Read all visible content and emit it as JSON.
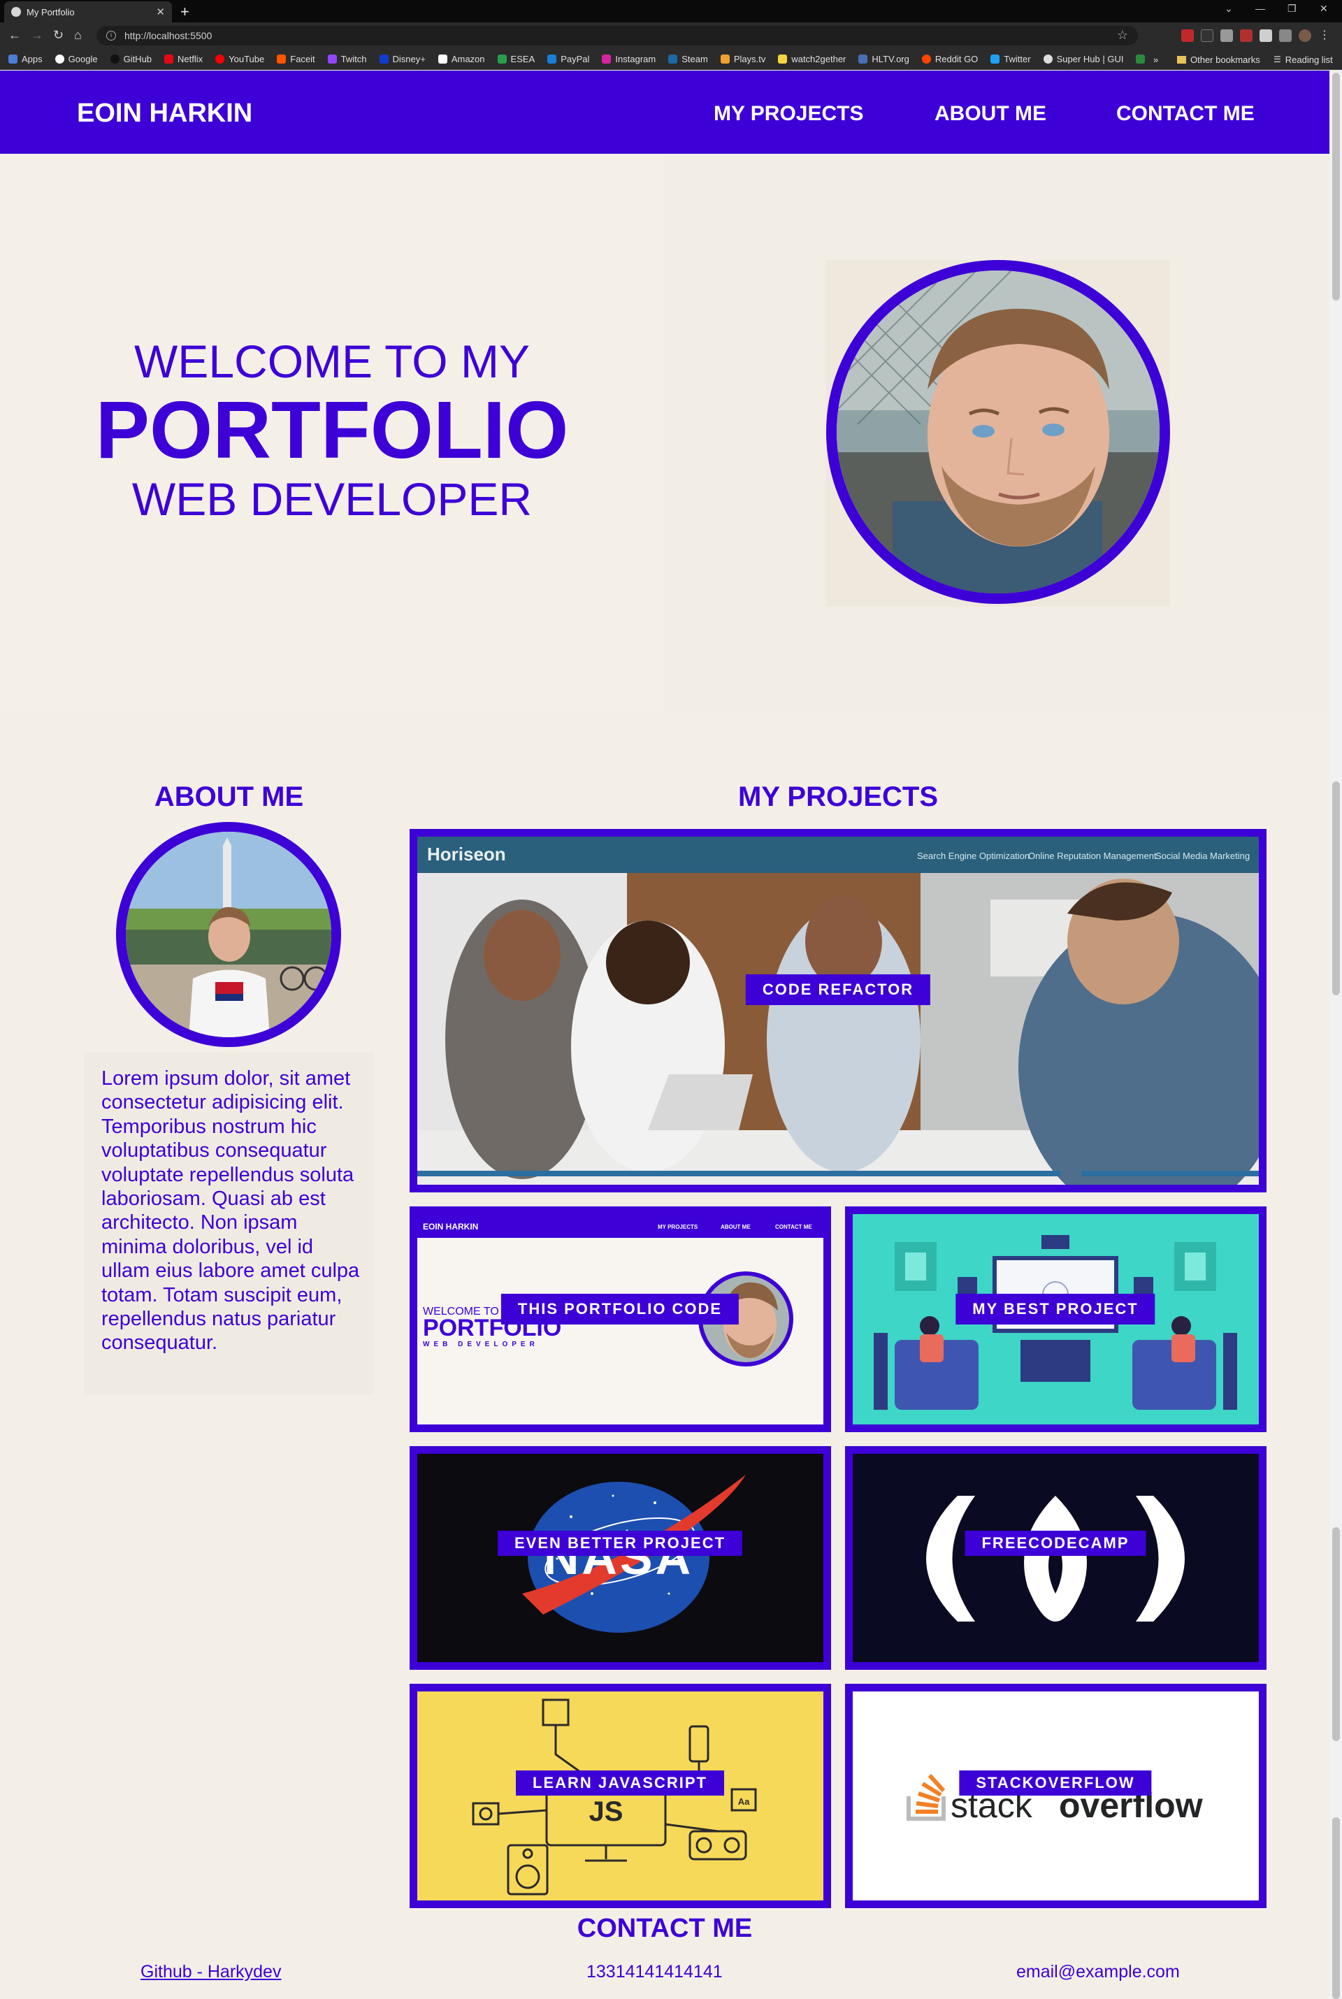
{
  "browser": {
    "tab_title": "My Portfolio",
    "url": "http://localhost:5500",
    "bookmarks": [
      "Apps",
      "Google",
      "GitHub",
      "Netflix",
      "YouTube",
      "Faceit",
      "Twitch",
      "Disney+",
      "Amazon",
      "ESEA",
      "PayPal",
      "Instagram",
      "Steam",
      "Plays.tv",
      "watch2gether",
      "HLTV.org",
      "Reddit GO",
      "Twitter",
      "Super Hub | GUI"
    ],
    "other_bookmarks": "Other bookmarks",
    "reading_list": "Reading list"
  },
  "nav": {
    "brand": "EOIN HARKIN",
    "links": [
      "MY PROJECTS",
      "ABOUT ME",
      "CONTACT ME"
    ]
  },
  "hero": {
    "line1": "WELCOME TO MY",
    "line2": "PORTFOLIO",
    "line3": "WEB DEVELOPER"
  },
  "about": {
    "title": "ABOUT ME",
    "text": "Lorem ipsum dolor, sit amet consectetur adipisicing elit. Temporibus nostrum hic voluptatibus consequatur voluptate repellendus soluta laboriosam. Quasi ab est architecto. Non ipsam minima doloribus, vel id ullam eius labore amet culpa totam. Totam suscipit eum, repellendus natus pariatur consequatur."
  },
  "projects": {
    "title": "MY PROJECTS",
    "items": [
      {
        "label": "CODE REFACTOR"
      },
      {
        "label": "THIS PORTFOLIO CODE"
      },
      {
        "label": "MY BEST PROJECT"
      },
      {
        "label": "EVEN BETTER PROJECT"
      },
      {
        "label": "FREECODECAMP"
      },
      {
        "label": "LEARN JAVASCRIPT"
      },
      {
        "label": "STACKOVERFLOW"
      }
    ],
    "thumbnails": {
      "horiseon_brand": "Horiseon",
      "horiseon_nav": [
        "Search Engine Optimization",
        "Online Reputation Management",
        "Social Media Marketing"
      ],
      "portfolio_brand": "EOIN HARKIN",
      "portfolio_nav": [
        "MY PROJECTS",
        "ABOUT ME",
        "CONTACT ME"
      ],
      "portfolio_line1": "WELCOME TO M",
      "portfolio_line2": "PORTFOLIO",
      "portfolio_line3": "WEB DEVELOPER",
      "nasa": "NASA",
      "js": "JS",
      "aa": "Aa",
      "stack_a": "stack",
      "stack_b": "overflow"
    }
  },
  "contact": {
    "title": "CONTACT ME",
    "github": "Github - Harkydev",
    "phone": "13314141414141",
    "email": "email@example.com"
  },
  "colors": {
    "accent": "#3d00d6",
    "background": "#f3efe7"
  }
}
